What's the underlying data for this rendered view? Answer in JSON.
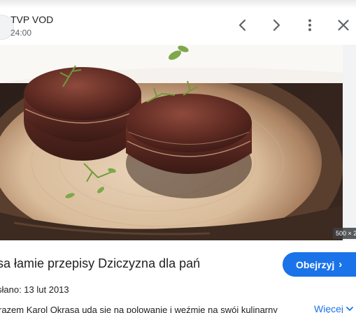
{
  "header": {
    "source_name": "TVP VOD",
    "duration": "24:00",
    "icons": [
      "favicon",
      "chevron-left-icon",
      "chevron-right-icon",
      "more-vert-icon",
      "close-icon"
    ]
  },
  "image": {
    "alt": "",
    "dimensions_label": "500 × 2"
  },
  "content": {
    "title": "asa łamie przepisy Dziczyzna dla pań",
    "watch_label": "Obejrzyj",
    "published": "słano: 13 lut 2013",
    "description": "razem Karol Okrasa uda się na polowanie i weźmie na swój kulinarny",
    "more_label": "Więcej"
  },
  "colors": {
    "accent": "#1a73e8",
    "text": "#202124",
    "muted": "#5f6368",
    "icon": "#5f6368"
  }
}
